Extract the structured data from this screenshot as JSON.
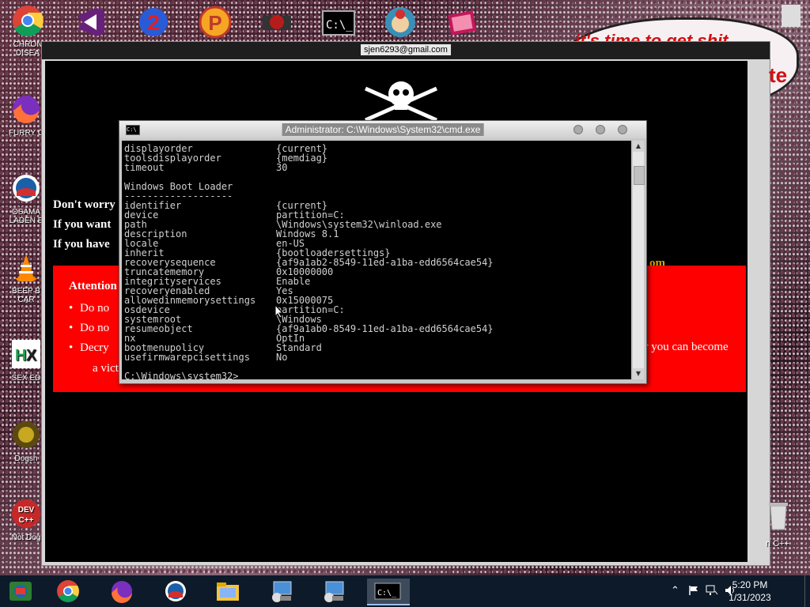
{
  "desktop": {
    "icons": [
      {
        "label": "CHRON\nDISEA"
      },
      {
        "label": "FURRY C"
      },
      {
        "label": "OSAMA\nLADEN B"
      },
      {
        "label": "BEEP B\nCAR"
      },
      {
        "label": "SEX ED"
      },
      {
        "label": "Dogsh"
      },
      {
        "label": "Not Dog"
      }
    ],
    "right_icon_label": "n C++",
    "bubble_text": "it's time to get shit",
    "bubble_fragment": "te"
  },
  "ransom": {
    "title": "sjen6293@gmail.com",
    "line1": "Don't worry",
    "line2": "If you want",
    "line3": "If you have",
    "line3_tail": "om",
    "attention_title": "Attention",
    "items": [
      "Do no",
      "Do no",
      "Decry"
    ],
    "item3_tail": "or you can become",
    "victim_fragment": "a vict"
  },
  "cmd": {
    "title": "Administrator: C:\\Windows\\System32\\cmd.exe",
    "rows": [
      {
        "key": "displayorder",
        "value": "{current}"
      },
      {
        "key": "toolsdisplayorder",
        "value": "{memdiag}"
      },
      {
        "key": "timeout",
        "value": "30"
      },
      {
        "key": "",
        "value": ""
      },
      {
        "key": "Windows Boot Loader",
        "value": ""
      },
      {
        "key": "-------------------",
        "value": ""
      },
      {
        "key": "identifier",
        "value": "{current}"
      },
      {
        "key": "device",
        "value": "partition=C:"
      },
      {
        "key": "path",
        "value": "\\Windows\\system32\\winload.exe"
      },
      {
        "key": "description",
        "value": "Windows 8.1"
      },
      {
        "key": "locale",
        "value": "en-US"
      },
      {
        "key": "inherit",
        "value": "{bootloadersettings}"
      },
      {
        "key": "recoverysequence",
        "value": "{af9a1ab2-8549-11ed-a1ba-edd6564cae54}"
      },
      {
        "key": "truncatememory",
        "value": "0x10000000"
      },
      {
        "key": "integrityservices",
        "value": "Enable"
      },
      {
        "key": "recoveryenabled",
        "value": "Yes"
      },
      {
        "key": "allowedinmemorysettings",
        "value": "0x15000075"
      },
      {
        "key": "osdevice",
        "value": "partition=C:"
      },
      {
        "key": "systemroot",
        "value": "\\Windows"
      },
      {
        "key": "resumeobject",
        "value": "{af9a1ab0-8549-11ed-a1ba-edd6564cae54}"
      },
      {
        "key": "nx",
        "value": "OptIn"
      },
      {
        "key": "bootmenupolicy",
        "value": "Standard"
      },
      {
        "key": "usefirmwarepcisettings",
        "value": "No"
      },
      {
        "key": "",
        "value": ""
      },
      {
        "key": "C:\\Windows\\system32>",
        "value": ""
      }
    ]
  },
  "taskbar": {
    "time": "5:20 PM",
    "date": "1/31/2023"
  },
  "colors": {
    "attention_red": "#ff0000",
    "email_tail": "#e0a000",
    "taskbar": "#0d1a2a"
  }
}
